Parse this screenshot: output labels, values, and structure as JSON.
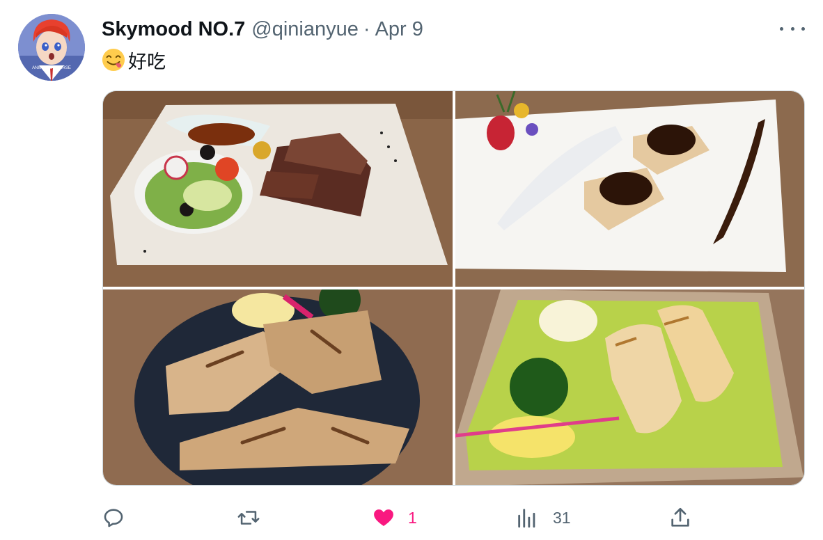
{
  "tweet": {
    "author_name": "Skymood NO.7",
    "handle": "@qinianyue",
    "separator": "·",
    "date": "Apr 9",
    "text": "好吃",
    "emoji": "face-savoring-food",
    "avatar_caption": "ANIMAN UNIVERSE"
  },
  "media": [
    {
      "icon": "steak-salad-plate-photo"
    },
    {
      "icon": "foie-gras-toast-plate-photo"
    },
    {
      "icon": "grilled-fish-dark-plate-photo"
    },
    {
      "icon": "grilled-fish-green-dish-photo"
    }
  ],
  "actions": {
    "reply": {
      "icon": "reply-icon",
      "count": ""
    },
    "retweet": {
      "icon": "retweet-icon",
      "count": ""
    },
    "like": {
      "icon": "heart-icon",
      "count": "1",
      "active": true,
      "color": "#f91880"
    },
    "views": {
      "icon": "views-icon",
      "count": "31"
    },
    "share": {
      "icon": "share-icon"
    }
  },
  "colors": {
    "text": "#0f1419",
    "muted": "#536471",
    "like": "#f91880",
    "border": "#cfd9de"
  }
}
